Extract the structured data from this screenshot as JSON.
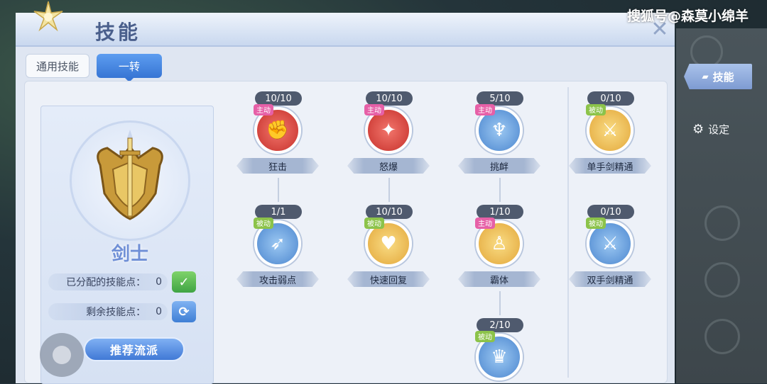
{
  "watermark": "搜狐号@森莫小绵羊",
  "window": {
    "title": "技能",
    "close_icon": "close-icon"
  },
  "tabs": [
    {
      "label": "通用技能",
      "active": false
    },
    {
      "label": "一转",
      "active": true
    }
  ],
  "side_menu": {
    "skill_tab": "技能",
    "settings_tab": "设定"
  },
  "class_card": {
    "name": "剑士",
    "allocated_label": "已分配的技能点：",
    "allocated_value": "0",
    "remaining_label": "剩余技能点：",
    "remaining_value": "0",
    "recommend_button": "推荐流派"
  },
  "skills": [
    {
      "count": "10/10",
      "type": "主动",
      "name": "狂击",
      "color": "#d9433e"
    },
    {
      "count": "10/10",
      "type": "主动",
      "name": "怒爆",
      "color": "#d9433e"
    },
    {
      "count": "5/10",
      "type": "主动",
      "name": "挑衅",
      "color": "#5c97d6"
    },
    {
      "count": "0/10",
      "type": "被动",
      "name": "单手剑精通",
      "color": "#e8b548"
    },
    {
      "count": "1/1",
      "type": "被动",
      "name": "攻击弱点",
      "color": "#5c97d6"
    },
    {
      "count": "10/10",
      "type": "被动",
      "name": "快速回复",
      "color": "#e8b548"
    },
    {
      "count": "1/10",
      "type": "主动",
      "name": "霸体",
      "color": "#e8b548"
    },
    {
      "count": "0/10",
      "type": "被动",
      "name": "双手剑精通",
      "color": "#5c97d6"
    },
    {
      "count": "2/10",
      "type": "被动",
      "name": "",
      "color": "#5c97d6"
    }
  ]
}
